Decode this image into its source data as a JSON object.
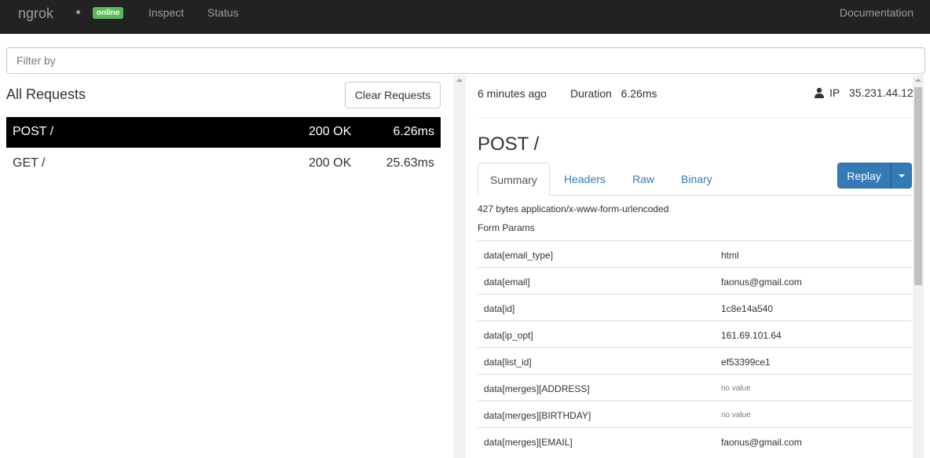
{
  "navbar": {
    "brand": "ngrok",
    "status_badge": "online",
    "links": {
      "inspect": "Inspect",
      "status": "Status",
      "documentation": "Documentation"
    }
  },
  "filter": {
    "placeholder": "Filter by",
    "value": ""
  },
  "requests_panel": {
    "title": "All Requests",
    "clear_label": "Clear Requests",
    "rows": [
      {
        "method_path": "POST /",
        "status": "200 OK",
        "duration": "6.26ms",
        "selected": true
      },
      {
        "method_path": "GET /",
        "status": "200 OK",
        "duration": "25.63ms",
        "selected": false
      }
    ]
  },
  "detail": {
    "time_ago": "6 minutes ago",
    "duration_label": "Duration",
    "duration_value": "6.26ms",
    "ip_label": "IP",
    "ip_value": "35.231.44.12",
    "title": "POST /",
    "tabs": [
      "Summary",
      "Headers",
      "Raw",
      "Binary"
    ],
    "active_tab": "Summary",
    "replay_label": "Replay",
    "body_info": "427 bytes application/x-www-form-urlencoded",
    "form_params_label": "Form Params",
    "params": [
      {
        "key": "data[email_type]",
        "value": "html"
      },
      {
        "key": "data[email]",
        "value": "faonus@gmail.com"
      },
      {
        "key": "data[id]",
        "value": "1c8e14a540"
      },
      {
        "key": "data[ip_opt]",
        "value": "161.69.101.64"
      },
      {
        "key": "data[list_id]",
        "value": "ef53399ce1"
      },
      {
        "key": "data[merges][ADDRESS]",
        "value": "no value"
      },
      {
        "key": "data[merges][BIRTHDAY]",
        "value": "no value"
      },
      {
        "key": "data[merges][EMAIL]",
        "value": "faonus@gmail.com"
      }
    ]
  },
  "icons": {
    "status_dot": "dot-icon",
    "user": "user-icon",
    "caret": "caret-down-icon"
  },
  "colors": {
    "navbar_bg": "#222222",
    "badge_green": "#5cb85c",
    "primary_blue": "#337ab7",
    "selected_row": "#000000"
  }
}
